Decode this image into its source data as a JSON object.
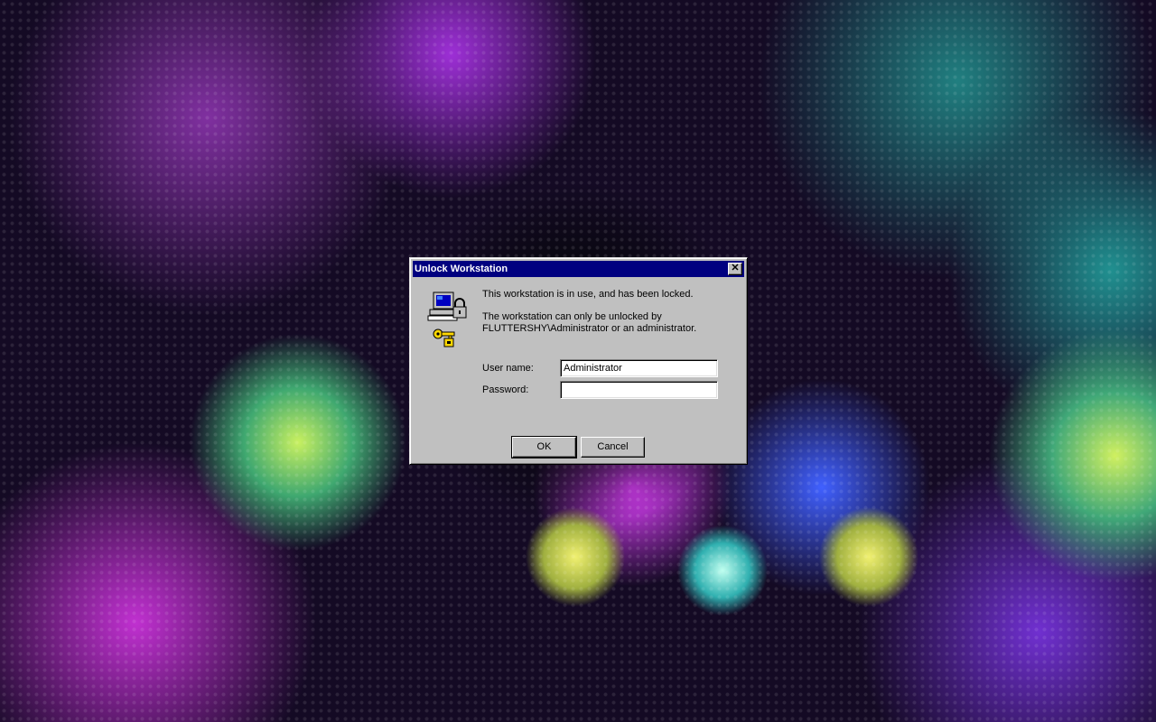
{
  "dialog": {
    "title": "Unlock Workstation",
    "close_glyph": "✕",
    "message_line1": "This workstation is in use, and has been locked.",
    "message_line2": "The workstation can only be unlocked by",
    "message_line3": "FLUTTERSHY\\Administrator or an administrator.",
    "icon": "computer-lock-key-icon"
  },
  "form": {
    "username_label": "User name:",
    "username_value": "Administrator",
    "password_label": "Password:",
    "password_value": ""
  },
  "buttons": {
    "ok_label": "OK",
    "cancel_label": "Cancel"
  },
  "colors": {
    "titlebar": "#000080",
    "dialog_face": "#c0c0c0"
  }
}
